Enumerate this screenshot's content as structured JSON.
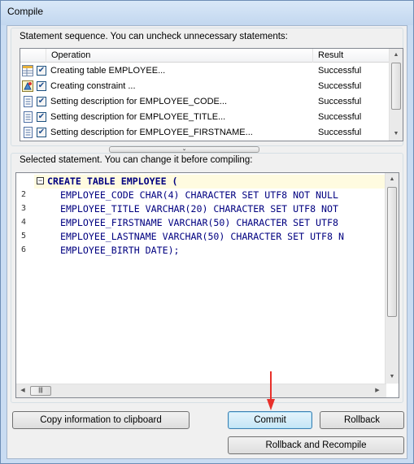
{
  "window": {
    "title": "Compile"
  },
  "statements": {
    "caption": "Statement sequence. You can uncheck unnecessary statements:",
    "columns": {
      "operation": "Operation",
      "result": "Result"
    },
    "rows": [
      {
        "icon": "table-icon",
        "checked": true,
        "operation": "Creating table EMPLOYEE...",
        "result": "Successful"
      },
      {
        "icon": "constraint-icon",
        "checked": true,
        "operation": "Creating constraint ...",
        "result": "Successful"
      },
      {
        "icon": "document-icon",
        "checked": true,
        "operation": "Setting description for EMPLOYEE_CODE...",
        "result": "Successful"
      },
      {
        "icon": "document-icon",
        "checked": true,
        "operation": "Setting description for EMPLOYEE_TITLE...",
        "result": "Successful"
      },
      {
        "icon": "document-icon",
        "checked": true,
        "operation": "Setting description for EMPLOYEE_FIRSTNAME...",
        "result": "Successful"
      }
    ]
  },
  "editor": {
    "caption": "Selected statement. You can change it before compiling:",
    "line_numbers": [
      "",
      "2",
      "3",
      "4",
      "5",
      "6"
    ],
    "lines": [
      "CREATE TABLE EMPLOYEE (",
      "  EMPLOYEE_CODE CHAR(4) CHARACTER SET UTF8 NOT NULL",
      "  EMPLOYEE_TITLE VARCHAR(20) CHARACTER SET UTF8 NOT",
      "  EMPLOYEE_FIRSTNAME VARCHAR(50) CHARACTER SET UTF8",
      "  EMPLOYEE_LASTNAME VARCHAR(50) CHARACTER SET UTF8 N",
      "  EMPLOYEE_BIRTH DATE);"
    ]
  },
  "buttons": {
    "copy": "Copy information to clipboard",
    "commit": "Commit",
    "rollback": "Rollback",
    "rollback_recompile": "Rollback and Recompile"
  },
  "colors": {
    "annotation_arrow": "#e8302a",
    "keyword": "#000080",
    "type": "#800080"
  }
}
